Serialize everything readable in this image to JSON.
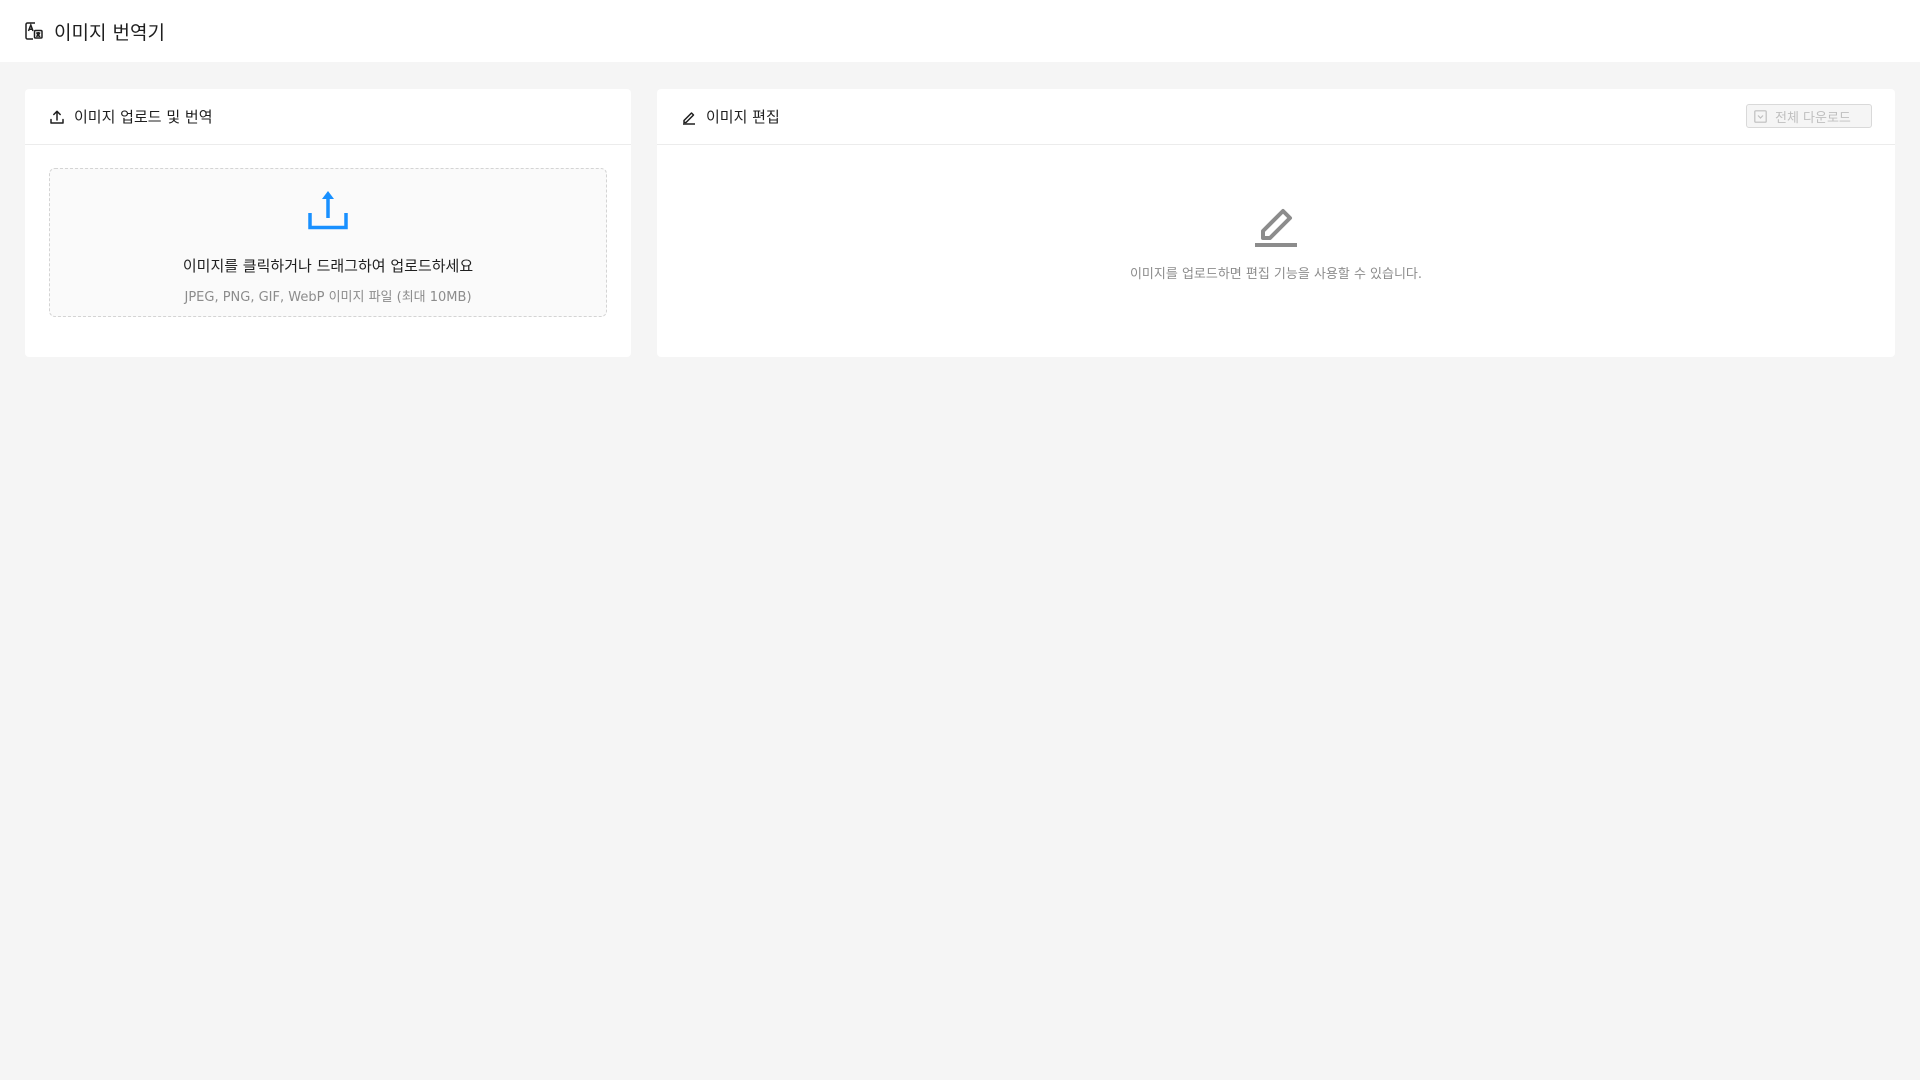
{
  "app": {
    "title": "이미지 번역기",
    "logo_icon": "image-translate-icon"
  },
  "upload_panel": {
    "title": "이미지 업로드 및 번역",
    "header_icon": "upload-icon",
    "dropzone": {
      "icon": "upload-arrow-icon",
      "icon_color": "#1890ff",
      "text": "이미지를 클릭하거나 드래그하여 업로드하세요",
      "hint": "JPEG, PNG, GIF, WebP 이미지 파일 (최대 10MB)"
    }
  },
  "edit_panel": {
    "title": "이미지 편집",
    "header_icon": "edit-icon",
    "download_all_label": "전체 다운로드",
    "download_all_disabled": true,
    "empty_state": {
      "icon": "edit-icon",
      "text": "이미지를 업로드하면 편집 기능을 사용할 수 있습니다."
    }
  },
  "colors": {
    "background": "#f5f5f5",
    "card": "#ffffff",
    "accent": "#1890ff",
    "muted_text": "#8c8c8c"
  }
}
